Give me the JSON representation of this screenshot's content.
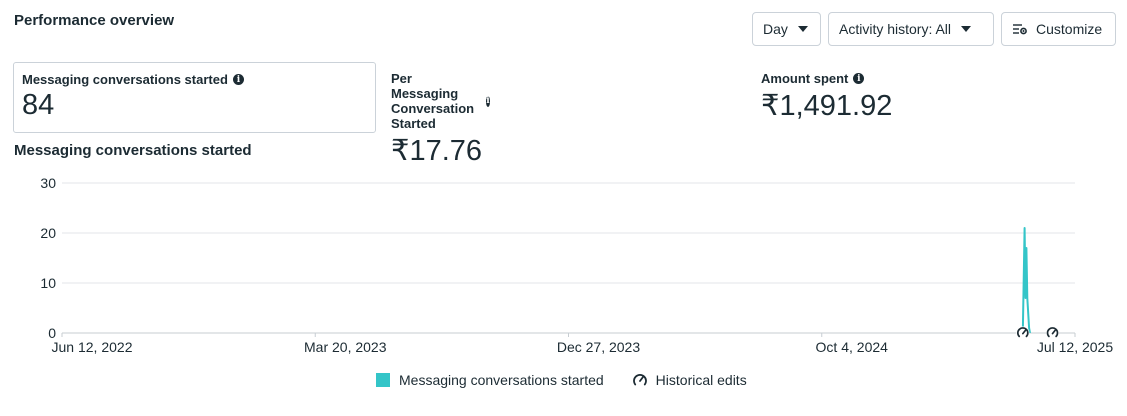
{
  "header": {
    "title": "Performance overview"
  },
  "toolbar": {
    "day_label": "Day",
    "activity_label": "Activity history: All",
    "customize_label": "Customize"
  },
  "cards": [
    {
      "label": "Messaging conversations started",
      "value": "84"
    },
    {
      "label": "Per Messaging Conversation Started",
      "value": "₹17.76"
    },
    {
      "label": "Amount spent",
      "value": "₹1,491.92"
    }
  ],
  "chart_title": "Messaging conversations started",
  "legend": {
    "series_label": "Messaging conversations started",
    "edits_label": "Historical edits"
  },
  "colors": {
    "series": "#34c5c8",
    "grid": "#e3e6e9"
  },
  "chart_data": {
    "type": "line",
    "x_tick_labels": [
      "Jun 12, 2022",
      "Mar 20, 2023",
      "Dec 27, 2023",
      "Oct 4, 2024",
      "Jul 12, 2025"
    ],
    "x_range": [
      "2022-06-12",
      "2025-07-12"
    ],
    "ylim": [
      0,
      30
    ],
    "y_ticks": [
      0,
      10,
      20,
      30
    ],
    "grid": true,
    "series": [
      {
        "name": "Messaging conversations started",
        "points": [
          [
            "2025-05-15",
            0
          ],
          [
            "2025-05-17",
            21
          ],
          [
            "2025-05-18",
            7
          ],
          [
            "2025-05-19",
            17
          ],
          [
            "2025-05-20",
            7
          ],
          [
            "2025-05-22",
            1
          ],
          [
            "2025-05-23",
            0
          ]
        ]
      }
    ],
    "historical_edits": [
      "2025-05-15",
      "2025-06-17"
    ]
  }
}
